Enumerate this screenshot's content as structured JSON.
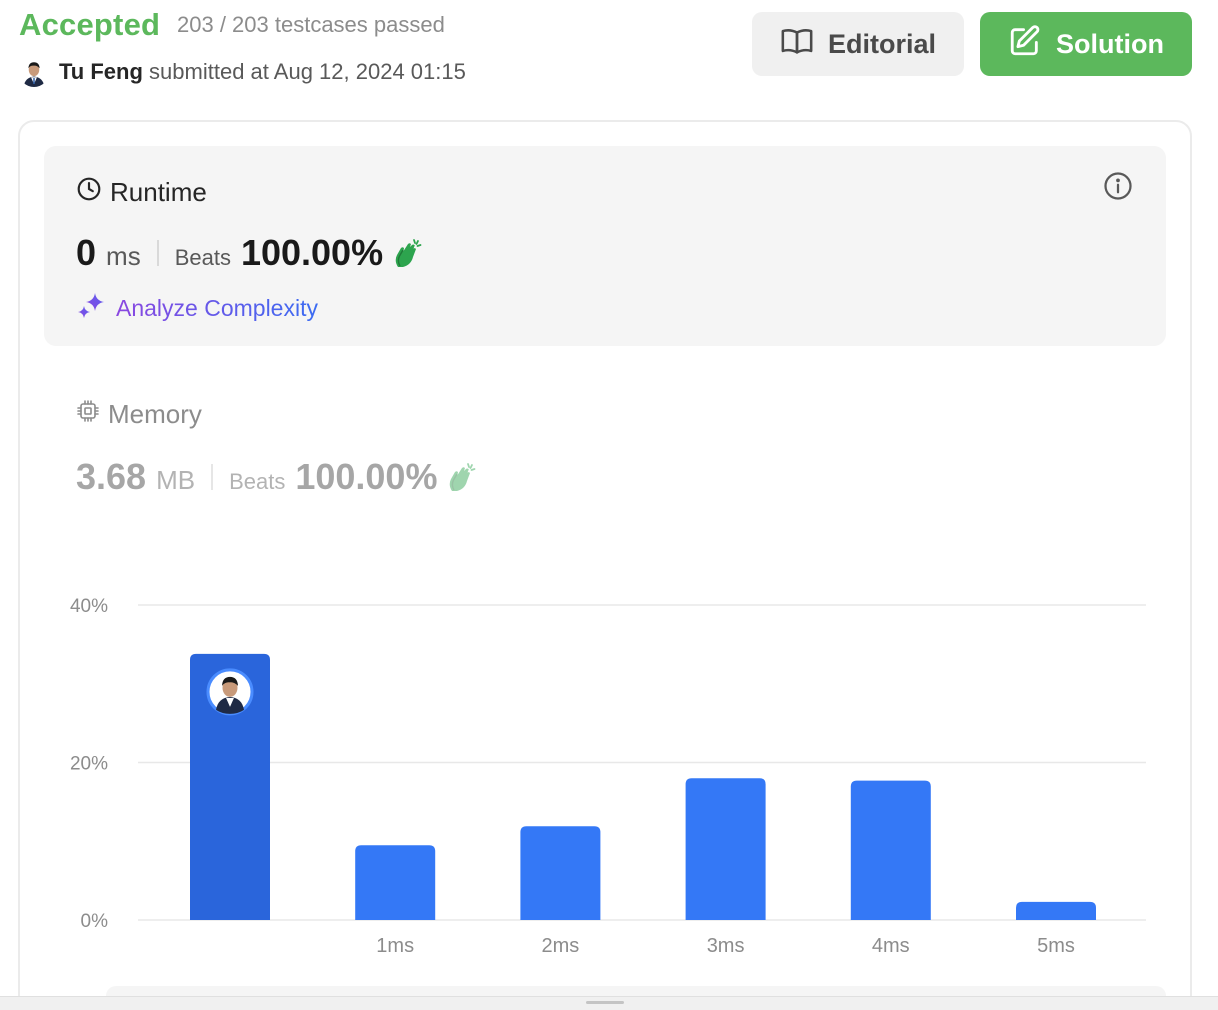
{
  "submission": {
    "status": "Accepted",
    "testcases": "203 / 203 testcases passed",
    "user": "Tu Feng",
    "submitted_text": "submitted at Aug 12, 2024 01:15"
  },
  "buttons": {
    "editorial": "Editorial",
    "solution": "Solution"
  },
  "runtime": {
    "title": "Runtime",
    "value": "0",
    "unit": "ms",
    "beats_label": "Beats",
    "beats_value": "100.00%",
    "analyze_label": "Analyze Complexity"
  },
  "memory": {
    "title": "Memory",
    "value": "3.68",
    "unit": "MB",
    "beats_label": "Beats",
    "beats_value": "100.00%"
  },
  "icons": {
    "editorial": "book-open-icon",
    "solution": "edit-icon",
    "runtime": "clock-icon",
    "memory": "chip-icon",
    "info": "info-icon",
    "analyze": "sparkles-icon",
    "beats": "clap-icon"
  },
  "colors": {
    "accepted": "#5cb85c",
    "bar": "#3478f6",
    "bar_highlight": "#2a65db",
    "analyze_gradient_start": "#8b47e0",
    "analyze_gradient_end": "#3b6cf2"
  },
  "chart_data": {
    "type": "bar",
    "categories": [
      "",
      "1ms",
      "2ms",
      "3ms",
      "4ms",
      "5ms"
    ],
    "values": [
      33.8,
      9.5,
      11.9,
      18.0,
      17.7,
      2.3
    ],
    "highlight_index": 0,
    "ylim": [
      0,
      40
    ],
    "yticks": [
      "0%",
      "20%",
      "40%"
    ],
    "grid": true
  }
}
